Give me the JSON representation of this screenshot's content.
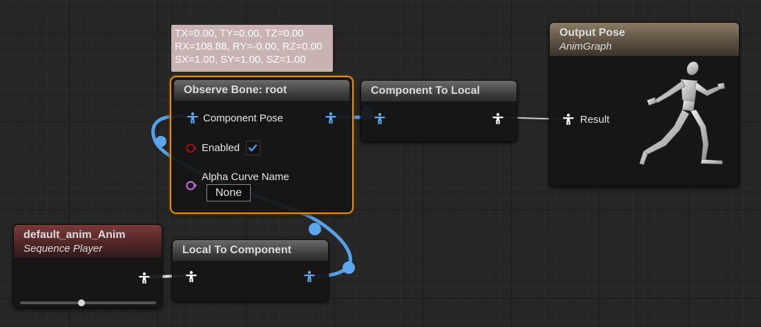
{
  "tooltip": {
    "line1": "TX=0.00, TY=0.00, TZ=0.00",
    "line2": "RX=108.88, RY=-0.00, RZ=0.00",
    "line3": "SX=1.00, SY=1.00, SZ=1.00"
  },
  "observe_bone": {
    "title": "Observe Bone: root",
    "pin_pose": "Component Pose",
    "pin_enabled": "Enabled",
    "enabled_checked": true,
    "pin_alpha": "Alpha Curve Name",
    "alpha_value": "None"
  },
  "component_to_local": {
    "title": "Component To Local"
  },
  "output_pose": {
    "title": "Output Pose",
    "subtitle": "AnimGraph",
    "pin_result": "Result"
  },
  "sequence_player": {
    "title": "default_anim_Anim",
    "subtitle": "Sequence Player",
    "playback_position": 0.45
  },
  "local_to_component": {
    "title": "Local To Component"
  },
  "colors": {
    "selection": "#e8900c",
    "wire": "#5aa6f0",
    "pose_pin": "#ffffff",
    "component_pin": "#5fa8ef",
    "bool_pin": "#9b1212",
    "name_pin": "#bf6bd8",
    "output_header": "#7a6a55",
    "sequence_header": "#6b3030"
  },
  "icons": [
    "person-icon",
    "checkmark-icon",
    "bool-pin-icon",
    "name-pin-icon",
    "mannequin-icon"
  ]
}
